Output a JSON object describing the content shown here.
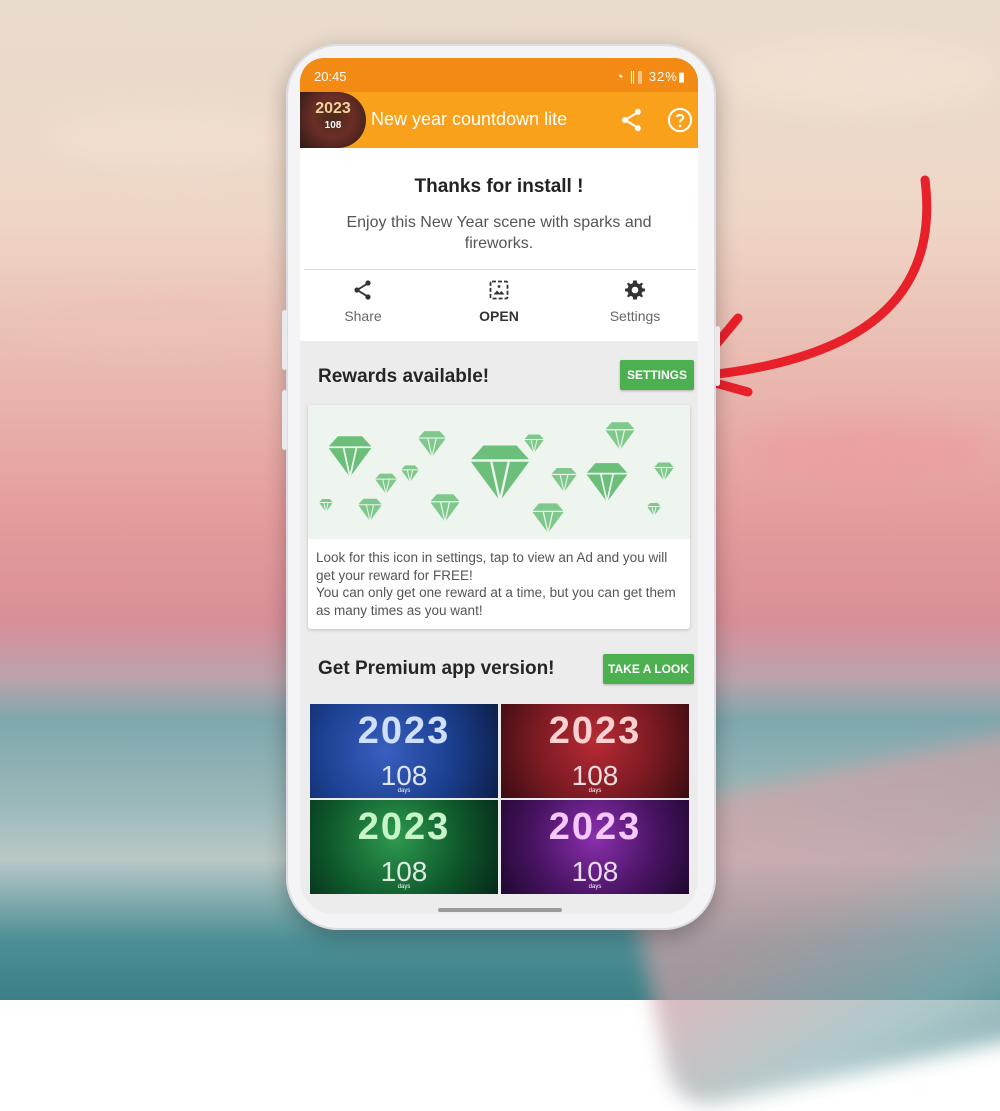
{
  "status_bar": {
    "time": "20:45",
    "right": "◔ ∥∥ 32%▮"
  },
  "app_bar": {
    "title": "New year countdown lite",
    "icon_year": "2023",
    "icon_days": "108",
    "share_icon": "share-icon",
    "help_icon": "help-icon"
  },
  "install_card": {
    "title": "Thanks for install !",
    "description": "Enjoy this New Year scene with sparks and fireworks.",
    "actions": [
      {
        "label": "Share",
        "icon": "share-icon"
      },
      {
        "label": "OPEN",
        "icon": "open-image-icon"
      },
      {
        "label": "Settings",
        "icon": "gear-icon"
      }
    ]
  },
  "rewards": {
    "title": "Rewards available!",
    "button": "SETTINGS",
    "text_line1": "Look for this icon in settings, tap to view an Ad and you will get your reward for FREE!",
    "text_line2": "You can only get one reward at a time, but you can get them as many times as you want!",
    "icon": "diamond-icon"
  },
  "premium": {
    "title": "Get Premium app version!",
    "button": "TAKE A LOOK",
    "tiles": [
      {
        "year": "2023",
        "days": "108",
        "label": "days",
        "color": "#1b3f8f"
      },
      {
        "year": "2023",
        "days": "108",
        "label": "days",
        "color": "#7a1a22"
      },
      {
        "year": "2023",
        "days": "108",
        "label": "days",
        "color": "#0f5a2c"
      },
      {
        "year": "2023",
        "days": "108",
        "label": "days",
        "color": "#4a1464"
      }
    ]
  },
  "colors": {
    "status_bar": "#f28a13",
    "app_bar": "#f9a11b",
    "button_green": "#4caf50",
    "arrow": "#e8202a"
  }
}
